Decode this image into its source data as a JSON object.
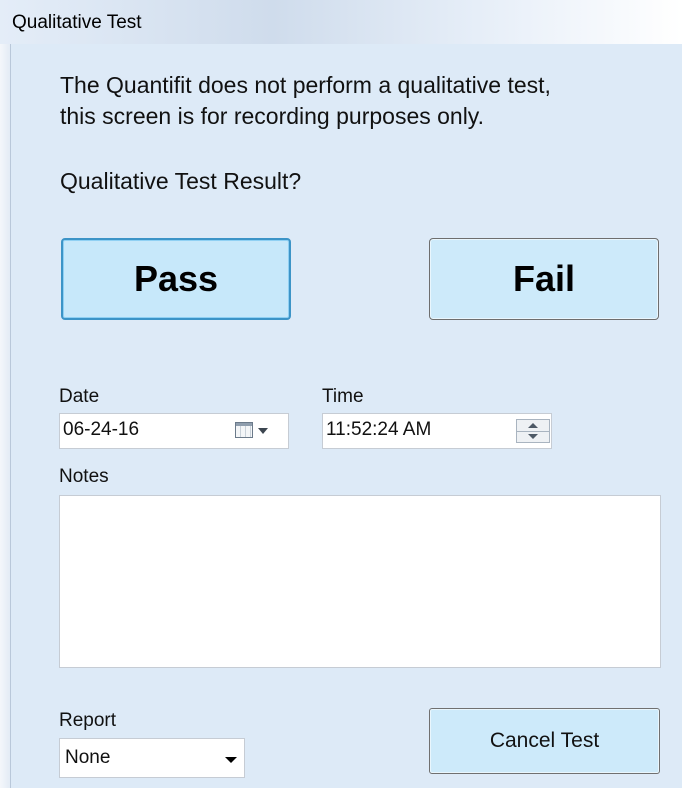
{
  "window": {
    "title": "Qualitative Test"
  },
  "intro": {
    "line1": "The Quantifit does not perform a qualitative test,",
    "line2": "this screen is for recording purposes only."
  },
  "question": "Qualitative Test Result?",
  "buttons": {
    "pass": "Pass",
    "fail": "Fail",
    "cancel": "Cancel Test"
  },
  "date": {
    "label": "Date",
    "value": "06-24-16",
    "icon": "calendar-icon"
  },
  "time": {
    "label": "Time",
    "value": "11:52:24 AM",
    "icon": "spinner-icon"
  },
  "notes": {
    "label": "Notes",
    "value": ""
  },
  "report": {
    "label": "Report",
    "selected": "None"
  },
  "colors": {
    "client_bg": "#ddeaf7",
    "button_bg": "#cdeafa",
    "pass_border": "#3c94c7"
  }
}
